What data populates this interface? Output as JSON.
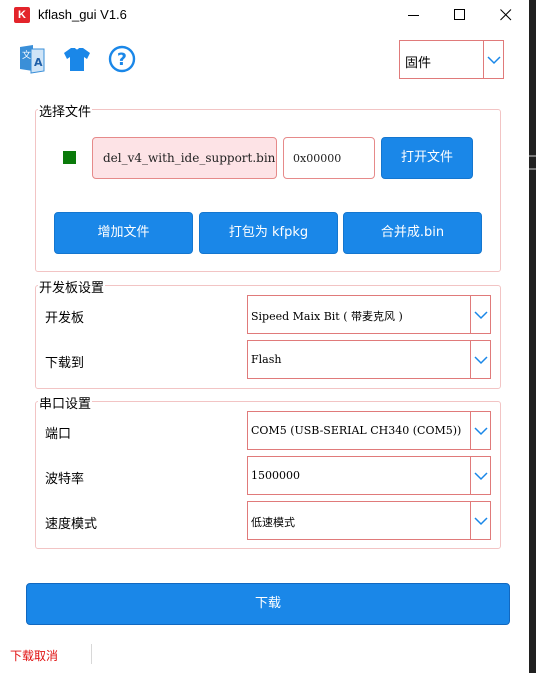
{
  "window": {
    "title": "kflash_gui V1.6",
    "logo_letter": "K"
  },
  "toolbar": {
    "icons": [
      "language-icon",
      "skin-icon",
      "help-icon"
    ],
    "firmware_select": "固件"
  },
  "file_group": {
    "title": "选择文件",
    "file_name": "del_v4_with_ide_support.bin",
    "address": "0x00000",
    "open_file_label": "打开文件",
    "add_file_label": "增加文件",
    "pack_kfpkg_label": "打包为 kfpkg",
    "merge_bin_label": "合并成.bin"
  },
  "board_group": {
    "title": "开发板设置",
    "board_label": "开发板",
    "board_value": "Sipeed Maix Bit ( 带麦克风 )",
    "download_to_label": "下载到",
    "download_to_value": "Flash"
  },
  "serial_group": {
    "title": "串口设置",
    "port_label": "端口",
    "port_value": "COM5 (USB-SERIAL CH340 (COM5))",
    "baud_label": "波特率",
    "baud_value": "1500000",
    "speed_label": "速度模式",
    "speed_value": "低速模式"
  },
  "download_button": "下载",
  "status_text": "下载取消",
  "colors": {
    "accent_blue": "#1a87e8",
    "border_red": "#e07a7a",
    "status_green": "#0a7a0a",
    "status_red": "#e01010"
  }
}
